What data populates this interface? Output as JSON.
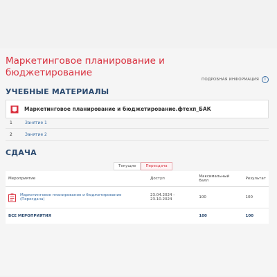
{
  "course": {
    "title": "Маркетинговое планирование и бюджетирование",
    "more_info": "ПОДРОБНАЯ ИНФОРМАЦИЯ"
  },
  "materials": {
    "section_title": "УЧЕБНЫЕ МАТЕРИАЛЫ",
    "file_name": "Маркетинговое планирование и бюджетирование.фтехп_БАК",
    "lessons": [
      {
        "num": "1",
        "label": "Занятие 1"
      },
      {
        "num": "2",
        "label": "Занятие 2"
      }
    ]
  },
  "exam": {
    "section_title": "СДАЧА",
    "tabs": [
      {
        "label": "Текущие",
        "active": false
      },
      {
        "label": "Пересдача",
        "active": true
      }
    ],
    "columns": {
      "event": "Мероприятие",
      "access": "Доступ",
      "max_score": "Максимальный балл",
      "result": "Результат"
    },
    "rows": [
      {
        "event": "Маркетинговое планирование и бюджетирование (Пересдача)",
        "access": "23.04.2024 - 23.10.2024",
        "max_score": "100",
        "result": "100"
      }
    ],
    "total": {
      "label": "ВСЕ МЕРОПРИЯТИЯ",
      "max_score": "100",
      "result": "100"
    }
  },
  "colors": {
    "accent_red": "#d9313f",
    "heading_blue": "#2b4a6f",
    "link_blue": "#3a6ea5"
  },
  "icons": {
    "info": "info-icon",
    "materials": "book-icon",
    "event": "clipboard-icon"
  }
}
